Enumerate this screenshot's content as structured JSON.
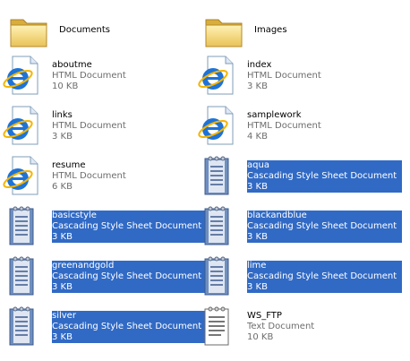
{
  "files": [
    {
      "name": "Documents",
      "type": "",
      "size": "",
      "icon": "folder-icon",
      "selected": false
    },
    {
      "name": "Images",
      "type": "",
      "size": "",
      "icon": "folder-icon",
      "selected": false
    },
    {
      "name": "aboutme",
      "type": "HTML Document",
      "size": "10 KB",
      "icon": "html-document-icon",
      "selected": false
    },
    {
      "name": "index",
      "type": "HTML Document",
      "size": "3 KB",
      "icon": "html-document-icon",
      "selected": false
    },
    {
      "name": "links",
      "type": "HTML Document",
      "size": "3 KB",
      "icon": "html-document-icon",
      "selected": false
    },
    {
      "name": "samplework",
      "type": "HTML Document",
      "size": "4 KB",
      "icon": "html-document-icon",
      "selected": false
    },
    {
      "name": "resume",
      "type": "HTML Document",
      "size": "6 KB",
      "icon": "html-document-icon",
      "selected": false
    },
    {
      "name": "aqua",
      "type": "Cascading Style Sheet Document",
      "size": "3 KB",
      "icon": "css-document-icon",
      "selected": true
    },
    {
      "name": "basicstyle",
      "type": "Cascading Style Sheet Document",
      "size": "3 KB",
      "icon": "css-document-icon",
      "selected": true
    },
    {
      "name": "blackandblue",
      "type": "Cascading Style Sheet Document",
      "size": "3 KB",
      "icon": "css-document-icon",
      "selected": true
    },
    {
      "name": "greenandgold",
      "type": "Cascading Style Sheet Document",
      "size": "3 KB",
      "icon": "css-document-icon",
      "selected": true
    },
    {
      "name": "lime",
      "type": "Cascading Style Sheet Document",
      "size": "3 KB",
      "icon": "css-document-icon",
      "selected": true
    },
    {
      "name": "silver",
      "type": "Cascading Style Sheet Document",
      "size": "3 KB",
      "icon": "css-document-icon",
      "selected": true
    },
    {
      "name": "WS_FTP",
      "type": "Text Document",
      "size": "10 KB",
      "icon": "text-document-icon",
      "selected": false
    }
  ],
  "colors": {
    "selection": "#316AC5",
    "subtext": "#6d6d6d"
  }
}
